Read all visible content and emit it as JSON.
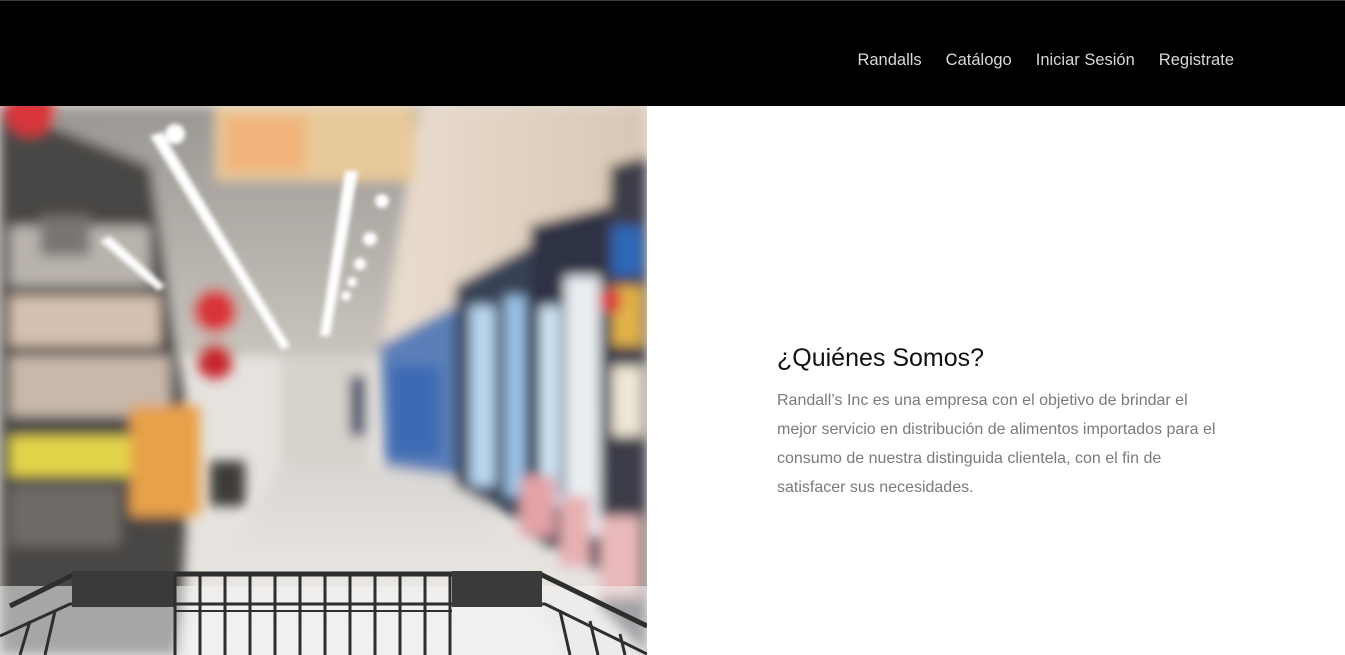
{
  "navbar": {
    "background": "#000000",
    "links": [
      {
        "label": "Randalls"
      },
      {
        "label": "Catálogo"
      },
      {
        "label": "Iniciar Sesión"
      },
      {
        "label": "Registrate"
      }
    ]
  },
  "hero": {
    "image_description_icon": "supermarket-aisle-photo"
  },
  "about": {
    "title": "¿Quiénes Somos?",
    "body": "Randall’s Inc es una empresa con el objetivo de brindar el mejor servicio en distribución de alimentos importados para el consumo de nuestra distinguida clientela, con el fin de satisfacer sus necesidades."
  }
}
